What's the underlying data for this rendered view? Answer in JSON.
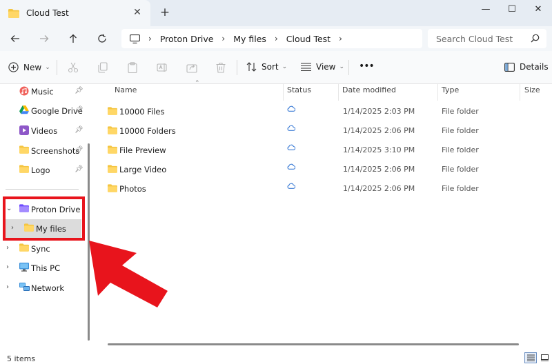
{
  "window": {
    "tab_title": "Cloud Test",
    "minimize_glyph": "—",
    "maximize_glyph": "☐",
    "close_glyph": "✕",
    "new_tab_glyph": "+"
  },
  "address": {
    "crumbs": [
      "Proton Drive",
      "My files",
      "Cloud Test"
    ],
    "search_placeholder": "Search Cloud Test"
  },
  "toolbar": {
    "new_label": "New",
    "sort_label": "Sort",
    "view_label": "View",
    "more_label": "•••",
    "details_label": "Details"
  },
  "sidebar": {
    "quick_access": [
      {
        "label": "Music",
        "icon": "music-icon"
      },
      {
        "label": "Google Drive",
        "icon": "google-drive-icon"
      },
      {
        "label": "Videos",
        "icon": "videos-icon"
      },
      {
        "label": "Screenshots",
        "icon": "folder-icon"
      },
      {
        "label": "Logo",
        "icon": "folder-icon"
      }
    ],
    "tree": [
      {
        "label": "Proton Drive",
        "icon": "proton-drive-icon",
        "expanded": true
      },
      {
        "label": "My files",
        "icon": "folder-icon",
        "selected": true
      },
      {
        "label": "Sync",
        "icon": "folder-icon"
      },
      {
        "label": "This PC",
        "icon": "pc-icon"
      },
      {
        "label": "Network",
        "icon": "network-icon"
      }
    ]
  },
  "columns": {
    "name": "Name",
    "status": "Status",
    "date": "Date modified",
    "type": "Type",
    "size": "Size"
  },
  "files": [
    {
      "name": "10000 Files",
      "date": "1/14/2025 2:03 PM",
      "type": "File folder"
    },
    {
      "name": "10000 Folders",
      "date": "1/14/2025 2:06 PM",
      "type": "File folder"
    },
    {
      "name": "File Preview",
      "date": "1/14/2025 3:10 PM",
      "type": "File folder"
    },
    {
      "name": "Large Video",
      "date": "1/14/2025 2:06 PM",
      "type": "File folder"
    },
    {
      "name": "Photos",
      "date": "1/14/2025 2:06 PM",
      "type": "File folder"
    }
  ],
  "status_bar": {
    "item_count": "5 items"
  },
  "colors": {
    "annotation_red": "#e8141c",
    "folder_yellow": "#f4c542",
    "cloud_blue": "#3a7bd5"
  }
}
